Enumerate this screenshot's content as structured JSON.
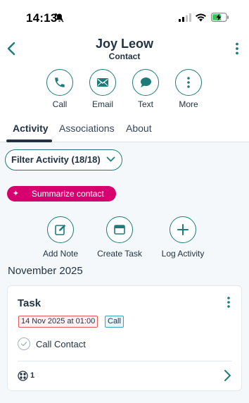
{
  "status_bar": {
    "time": "14:13"
  },
  "header": {
    "name": "Joy Leow",
    "subtitle": "Contact"
  },
  "actions": [
    {
      "label": "Call",
      "icon": "phone-icon"
    },
    {
      "label": "Email",
      "icon": "email-icon"
    },
    {
      "label": "Text",
      "icon": "chat-icon"
    },
    {
      "label": "More",
      "icon": "more-vertical-icon"
    }
  ],
  "tabs": [
    {
      "label": "Activity",
      "active": true
    },
    {
      "label": "Associations",
      "active": false
    },
    {
      "label": "About",
      "active": false
    }
  ],
  "filter": {
    "label": "Filter Activity (18/18)"
  },
  "summarize": {
    "label": "Summarize contact",
    "color": "#d6006e"
  },
  "quick_actions": [
    {
      "label": "Add Note",
      "icon": "edit-note-icon"
    },
    {
      "label": "Create Task",
      "icon": "task-icon"
    },
    {
      "label": "Log Activity",
      "icon": "plus-icon"
    }
  ],
  "timeline": {
    "month": "November 2025",
    "card": {
      "title": "Task",
      "date": "14 Nov 2025 at 01:00",
      "type": "Call",
      "task_name": "Call Contact",
      "association_count": "1"
    }
  },
  "colors": {
    "accent": "#1f7a7a",
    "text": "#213343",
    "background": "#f5f8fa"
  }
}
